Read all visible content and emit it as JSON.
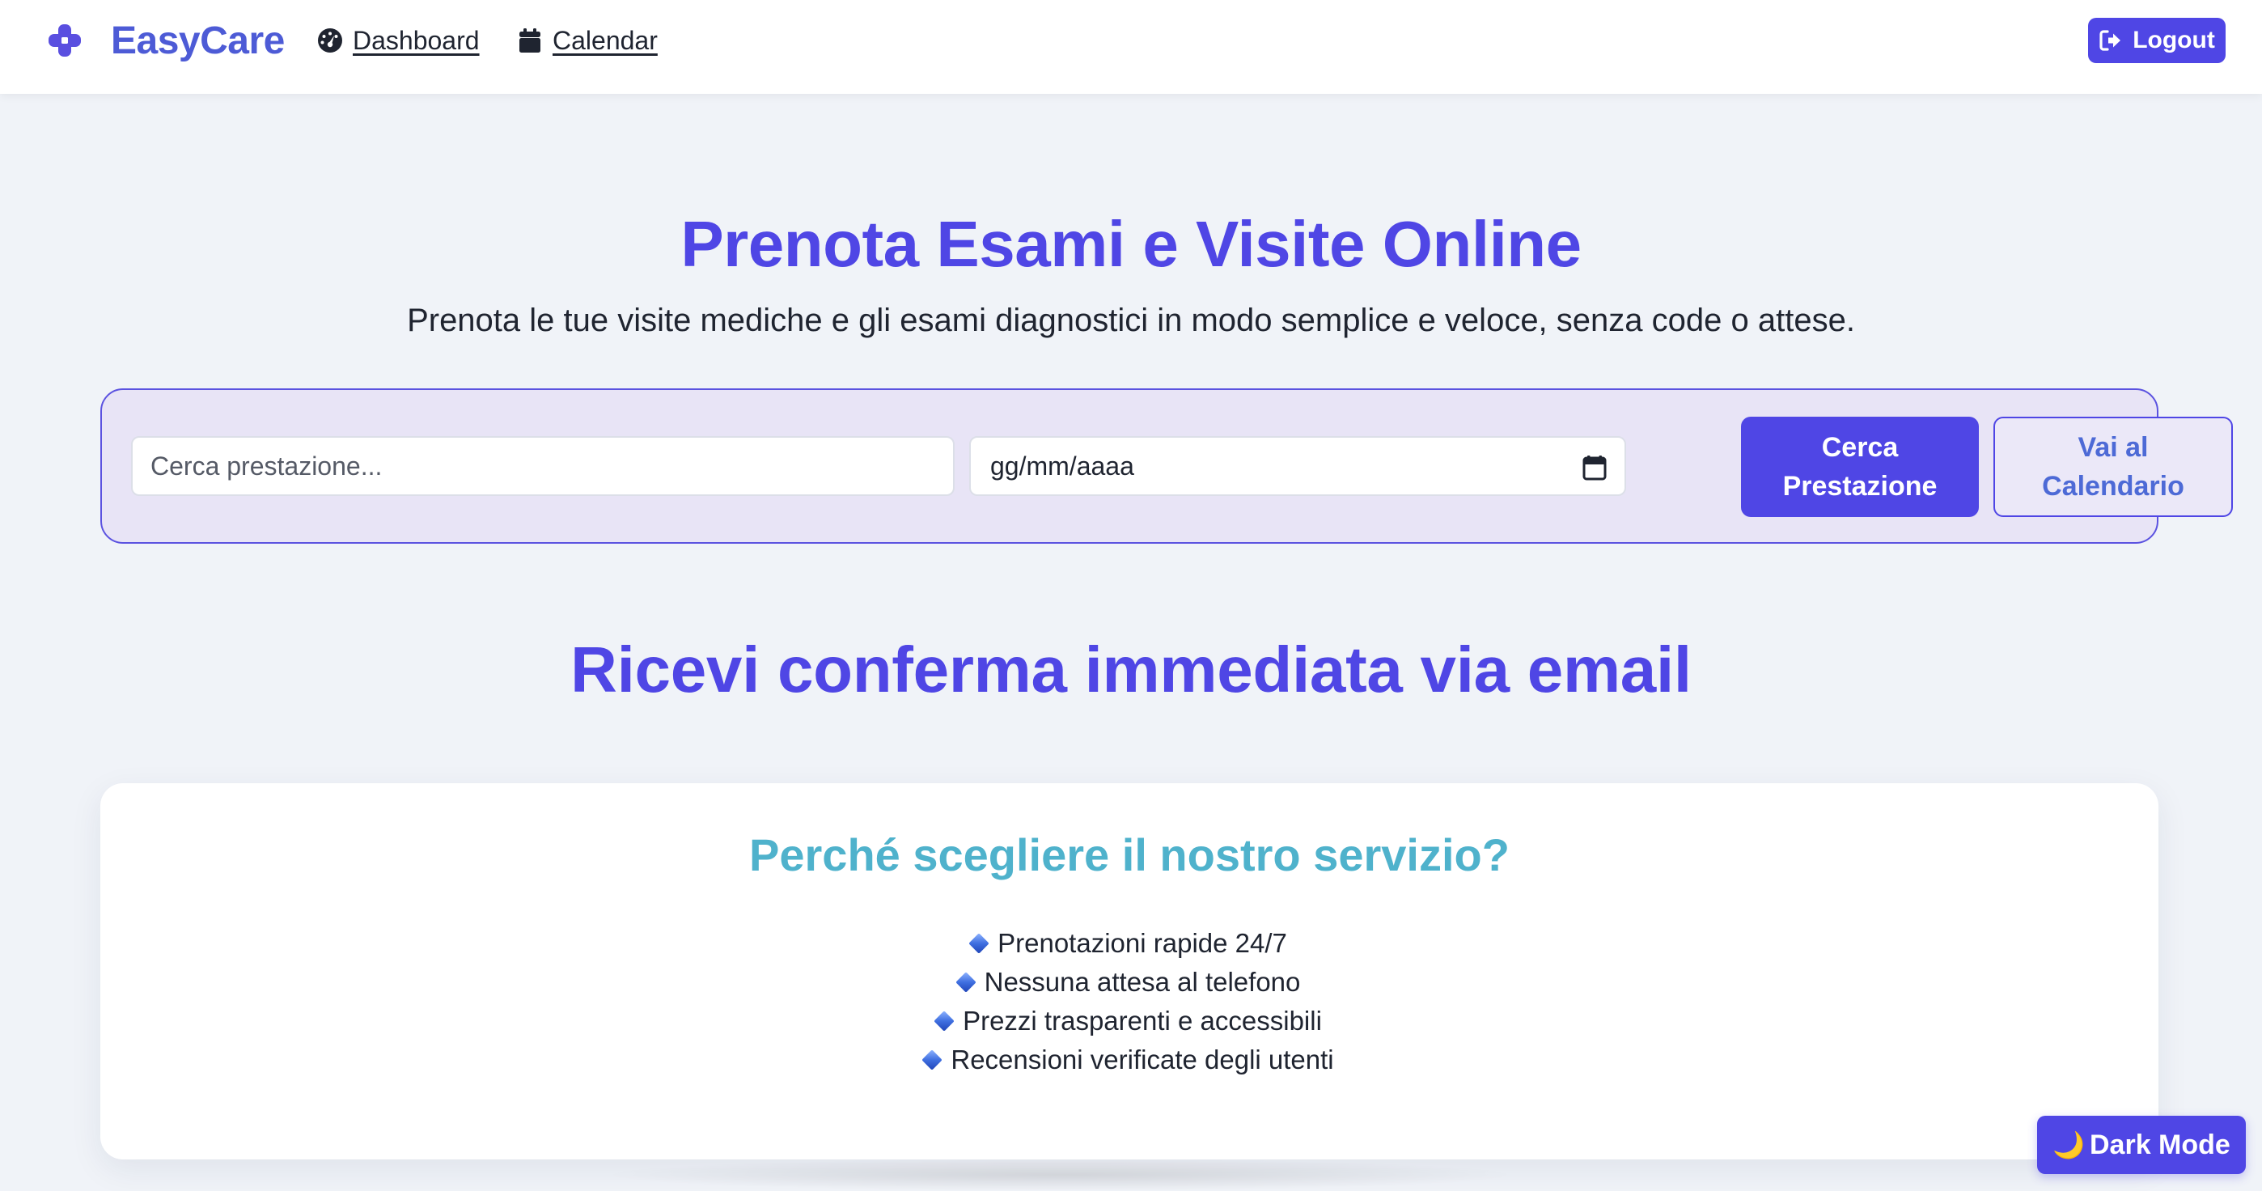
{
  "app": {
    "name": "EasyCare",
    "brand_color": "#4d5bd6",
    "accent_color": "#4f46e5"
  },
  "nav": {
    "links": [
      {
        "label": "Dashboard",
        "icon": "dashboard-gauge-icon"
      },
      {
        "label": "Calendar",
        "icon": "calendar-icon"
      }
    ],
    "logout_label": "Logout",
    "logout_icon": "logout-icon"
  },
  "hero": {
    "title": "Prenota Esami e Visite Online",
    "subtitle": "Prenota le tue visite mediche e gli esami diagnostici in modo semplice e veloce, senza code o attese."
  },
  "search": {
    "placeholder": "Cerca prestazione...",
    "value": "",
    "date_placeholder": "gg/mm/aaaa",
    "search_button": "Cerca Prestazione",
    "calendar_button": "Vai al Calendario"
  },
  "confirmation": {
    "title": "Ricevi conferma immediata via email"
  },
  "why_card": {
    "title": "Perché scegliere il nostro servizio?",
    "title_color": "#4fb2cc",
    "features": [
      "Prenotazioni rapide 24/7",
      "Nessuna attesa al telefono",
      "Prezzi trasparenti e accessibili",
      "Recensioni verificate degli utenti"
    ],
    "bullet_icon": "blue-diamond-icon"
  },
  "dark_mode": {
    "label": "Dark Mode",
    "icon": "moon-icon"
  }
}
